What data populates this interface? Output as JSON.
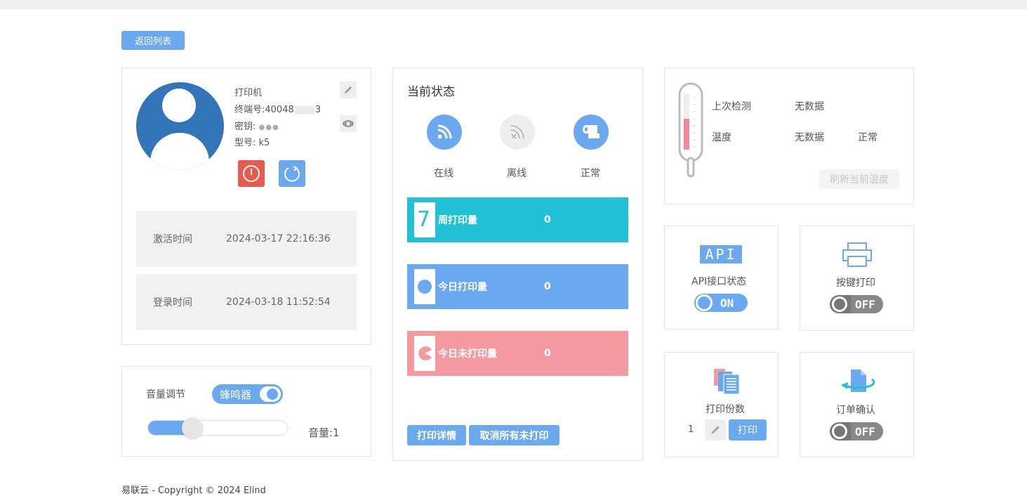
{
  "top": {
    "back_label": "返回列表"
  },
  "device": {
    "name_label": "打印机",
    "terminal_label": "终端号:40048",
    "terminal_tail": "3",
    "key_label": "密钥:",
    "key_mask": "●●●",
    "model_label": "型号: k5",
    "activate_label": "激活时间",
    "activate_time": "2024-03-17 22:16:36",
    "login_label": "登录时间",
    "login_time": "2024-03-18 11:52:54"
  },
  "volume": {
    "title": "音量调节",
    "buzzer_label": "蜂鸣器",
    "volume_text": "音量:1",
    "level_fraction": 0.2
  },
  "status": {
    "title": "当前状态",
    "online_label": "在线",
    "offline_label": "离线",
    "normal_label": "正常",
    "weekly_label": "周打印量",
    "weekly_value": "0",
    "weekly_icon_text": "7",
    "today_label": "今日打印量",
    "today_value": "0",
    "unprinted_label": "今日未打印量",
    "unprinted_value": "0",
    "detail_button": "打印详情",
    "cancel_button": "取消所有未打印"
  },
  "temperature": {
    "last_check_label": "上次检测",
    "last_check_value": "无数据",
    "temp_label": "温度",
    "temp_value": "无数据",
    "temp_status": "正常",
    "refresh_button": "刷新当前温度"
  },
  "api": {
    "badge": "API",
    "label": "API接口状态",
    "toggle": "ON"
  },
  "key_print": {
    "label": "按键打印",
    "toggle": "OFF"
  },
  "copies": {
    "label": "打印份数",
    "value": "1",
    "print_button": "打印"
  },
  "order_confirm": {
    "label": "订单确认",
    "toggle": "OFF"
  },
  "footer": {
    "text": "易联云 - Copyright © 2024 Elind"
  },
  "colors": {
    "accent": "#6aa9ef",
    "teal": "#21c0d4",
    "pink": "#f3999f",
    "red": "#e85a4f",
    "avatar": "#3275b9"
  }
}
